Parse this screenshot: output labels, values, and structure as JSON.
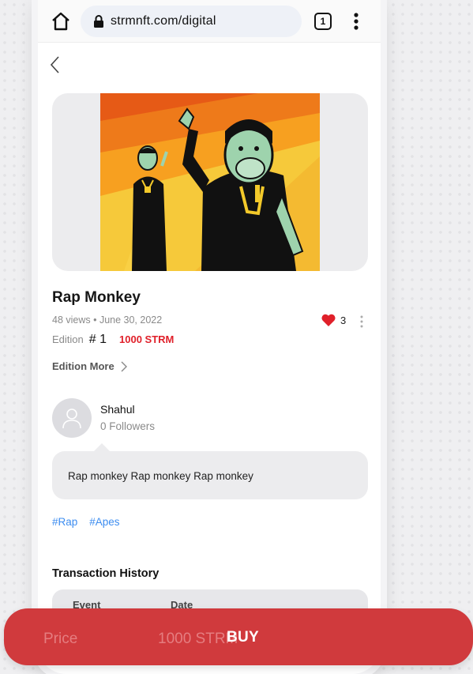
{
  "browser": {
    "url": "strmnft.com/digital",
    "tab_count": "1"
  },
  "nft": {
    "title": "Rap Monkey",
    "meta": "48 views • June 30, 2022",
    "likes": "3",
    "edition_label": "Edition",
    "edition_number": "# 1",
    "edition_price": "1000 STRM",
    "edition_more": "Edition More"
  },
  "creator": {
    "name": "Shahul",
    "followers": "0 Followers"
  },
  "description": "Rap monkey Rap monkey Rap monkey",
  "tags": [
    "#Rap",
    "#Apes"
  ],
  "transactions": {
    "title": "Transaction History",
    "headers": [
      "Event",
      "Date"
    ]
  },
  "buy_bar": {
    "price_label": "Price",
    "price_value": "1000 STRM",
    "buy_label": "BUY"
  },
  "colors": {
    "accent_red": "#d03a3d",
    "price_red": "#e0202a",
    "tag_blue": "#3d8df0"
  },
  "icons": [
    "home-icon",
    "lock-icon",
    "tabs-icon",
    "menu-icon",
    "back-icon",
    "heart-icon",
    "more-icon",
    "chevron-right-icon",
    "user-icon"
  ]
}
